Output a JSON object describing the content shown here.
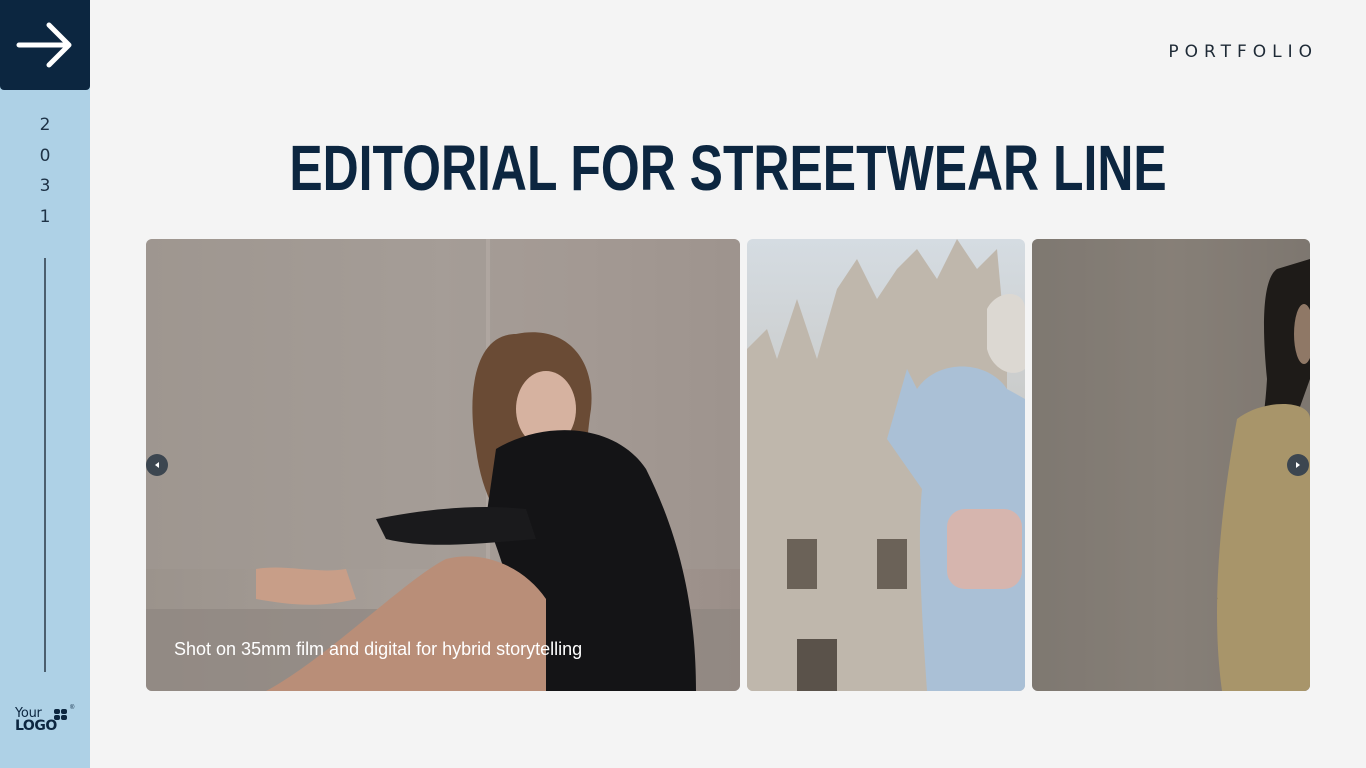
{
  "sidebar": {
    "nav_icon": "arrow-right-icon",
    "year_digits": [
      "2",
      "0",
      "3",
      "1"
    ],
    "logo": {
      "line1": "Your",
      "line2": "LOGO",
      "mark": "®"
    }
  },
  "header": {
    "section_label": "PORTFOLIO",
    "title": "EDITORIAL FOR STREETWEAR LINE"
  },
  "gallery": {
    "photos": [
      {
        "subject": "woman in black blazer seated against concrete wall",
        "caption": "Shot on 35mm film and digital for hybrid storytelling"
      },
      {
        "subject": "woman in light blue coat in front of cathedral"
      },
      {
        "subject": "woman in yellow coat in profile"
      }
    ],
    "prev_icon": "chevron-left-icon",
    "next_icon": "chevron-right-icon"
  },
  "colors": {
    "navy": "#0c2640",
    "sidebar_blue": "#aed1e6",
    "background": "#f4f4f4"
  }
}
